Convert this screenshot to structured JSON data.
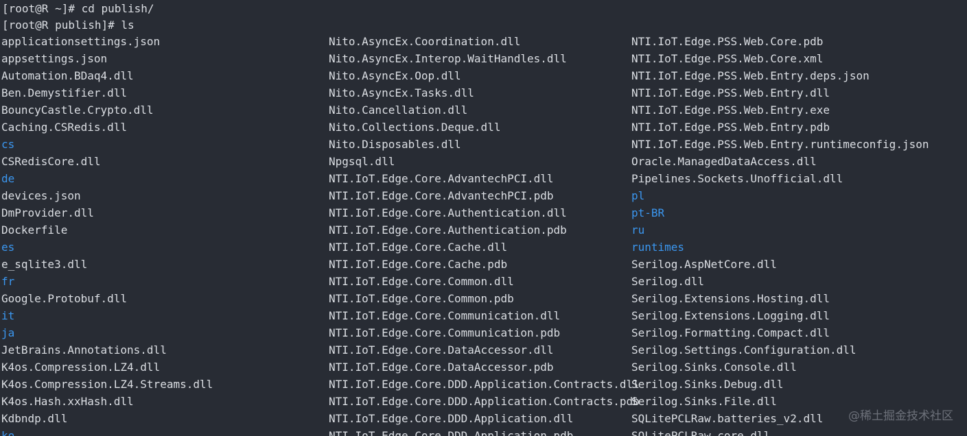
{
  "terminal": {
    "prompts": [
      {
        "prompt": "[root@R ~]# ",
        "command": "cd publish/"
      },
      {
        "prompt": "[root@R publish]# ",
        "command": "ls"
      }
    ],
    "columns": [
      [
        {
          "name": "applicationsettings.json",
          "type": "file"
        },
        {
          "name": "appsettings.json",
          "type": "file"
        },
        {
          "name": "Automation.BDaq4.dll",
          "type": "file"
        },
        {
          "name": "Ben.Demystifier.dll",
          "type": "file"
        },
        {
          "name": "BouncyCastle.Crypto.dll",
          "type": "file"
        },
        {
          "name": "Caching.CSRedis.dll",
          "type": "file"
        },
        {
          "name": "cs",
          "type": "dir"
        },
        {
          "name": "CSRedisCore.dll",
          "type": "file"
        },
        {
          "name": "de",
          "type": "dir"
        },
        {
          "name": "devices.json",
          "type": "file"
        },
        {
          "name": "DmProvider.dll",
          "type": "file"
        },
        {
          "name": "Dockerfile",
          "type": "file"
        },
        {
          "name": "es",
          "type": "dir"
        },
        {
          "name": "e_sqlite3.dll",
          "type": "file"
        },
        {
          "name": "fr",
          "type": "dir"
        },
        {
          "name": "Google.Protobuf.dll",
          "type": "file"
        },
        {
          "name": "it",
          "type": "dir"
        },
        {
          "name": "ja",
          "type": "dir"
        },
        {
          "name": "JetBrains.Annotations.dll",
          "type": "file"
        },
        {
          "name": "K4os.Compression.LZ4.dll",
          "type": "file"
        },
        {
          "name": "K4os.Compression.LZ4.Streams.dll",
          "type": "file"
        },
        {
          "name": "K4os.Hash.xxHash.dll",
          "type": "file"
        },
        {
          "name": "Kdbndp.dll",
          "type": "file"
        },
        {
          "name": "ko",
          "type": "dir"
        }
      ],
      [
        {
          "name": "Nito.AsyncEx.Coordination.dll",
          "type": "file"
        },
        {
          "name": "Nito.AsyncEx.Interop.WaitHandles.dll",
          "type": "file"
        },
        {
          "name": "Nito.AsyncEx.Oop.dll",
          "type": "file"
        },
        {
          "name": "Nito.AsyncEx.Tasks.dll",
          "type": "file"
        },
        {
          "name": "Nito.Cancellation.dll",
          "type": "file"
        },
        {
          "name": "Nito.Collections.Deque.dll",
          "type": "file"
        },
        {
          "name": "Nito.Disposables.dll",
          "type": "file"
        },
        {
          "name": "Npgsql.dll",
          "type": "file"
        },
        {
          "name": "NTI.IoT.Edge.Core.AdvantechPCI.dll",
          "type": "file"
        },
        {
          "name": "NTI.IoT.Edge.Core.AdvantechPCI.pdb",
          "type": "file"
        },
        {
          "name": "NTI.IoT.Edge.Core.Authentication.dll",
          "type": "file"
        },
        {
          "name": "NTI.IoT.Edge.Core.Authentication.pdb",
          "type": "file"
        },
        {
          "name": "NTI.IoT.Edge.Core.Cache.dll",
          "type": "file"
        },
        {
          "name": "NTI.IoT.Edge.Core.Cache.pdb",
          "type": "file"
        },
        {
          "name": "NTI.IoT.Edge.Core.Common.dll",
          "type": "file"
        },
        {
          "name": "NTI.IoT.Edge.Core.Common.pdb",
          "type": "file"
        },
        {
          "name": "NTI.IoT.Edge.Core.Communication.dll",
          "type": "file"
        },
        {
          "name": "NTI.IoT.Edge.Core.Communication.pdb",
          "type": "file"
        },
        {
          "name": "NTI.IoT.Edge.Core.DataAccessor.dll",
          "type": "file"
        },
        {
          "name": "NTI.IoT.Edge.Core.DataAccessor.pdb",
          "type": "file"
        },
        {
          "name": "NTI.IoT.Edge.Core.DDD.Application.Contracts.dll",
          "type": "file"
        },
        {
          "name": "NTI.IoT.Edge.Core.DDD.Application.Contracts.pdb",
          "type": "file"
        },
        {
          "name": "NTI.IoT.Edge.Core.DDD.Application.dll",
          "type": "file"
        },
        {
          "name": "NTI.IoT.Edge.Core.DDD.Application.pdb",
          "type": "file"
        }
      ],
      [
        {
          "name": "NTI.IoT.Edge.PSS.Web.Core.pdb",
          "type": "file"
        },
        {
          "name": "NTI.IoT.Edge.PSS.Web.Core.xml",
          "type": "file"
        },
        {
          "name": "NTI.IoT.Edge.PSS.Web.Entry.deps.json",
          "type": "file"
        },
        {
          "name": "NTI.IoT.Edge.PSS.Web.Entry.dll",
          "type": "file"
        },
        {
          "name": "NTI.IoT.Edge.PSS.Web.Entry.exe",
          "type": "file"
        },
        {
          "name": "NTI.IoT.Edge.PSS.Web.Entry.pdb",
          "type": "file"
        },
        {
          "name": "NTI.IoT.Edge.PSS.Web.Entry.runtimeconfig.json",
          "type": "file"
        },
        {
          "name": "Oracle.ManagedDataAccess.dll",
          "type": "file"
        },
        {
          "name": "Pipelines.Sockets.Unofficial.dll",
          "type": "file"
        },
        {
          "name": "pl",
          "type": "dir"
        },
        {
          "name": "pt-BR",
          "type": "dir"
        },
        {
          "name": "ru",
          "type": "dir"
        },
        {
          "name": "runtimes",
          "type": "dir"
        },
        {
          "name": "Serilog.AspNetCore.dll",
          "type": "file"
        },
        {
          "name": "Serilog.dll",
          "type": "file"
        },
        {
          "name": "Serilog.Extensions.Hosting.dll",
          "type": "file"
        },
        {
          "name": "Serilog.Extensions.Logging.dll",
          "type": "file"
        },
        {
          "name": "Serilog.Formatting.Compact.dll",
          "type": "file"
        },
        {
          "name": "Serilog.Settings.Configuration.dll",
          "type": "file"
        },
        {
          "name": "Serilog.Sinks.Console.dll",
          "type": "file"
        },
        {
          "name": "Serilog.Sinks.Debug.dll",
          "type": "file"
        },
        {
          "name": "Serilog.Sinks.File.dll",
          "type": "file"
        },
        {
          "name": "SQLitePCLRaw.batteries_v2.dll",
          "type": "file"
        },
        {
          "name": "SQLitePCLRaw.core.dll",
          "type": "file"
        }
      ]
    ],
    "colors": {
      "background": "#282c34",
      "text": "#dcdfe4",
      "directory": "#3b97f0"
    }
  },
  "watermark": {
    "text": "@稀土掘金技术社区"
  }
}
